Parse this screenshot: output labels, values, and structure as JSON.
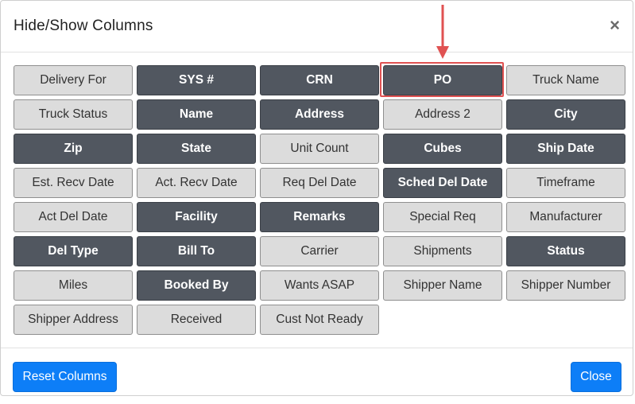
{
  "modal": {
    "title": "Hide/Show Columns",
    "close_glyph": "×"
  },
  "columns": [
    {
      "label": "Delivery For",
      "visible": false
    },
    {
      "label": "SYS #",
      "visible": true
    },
    {
      "label": "CRN",
      "visible": true
    },
    {
      "label": "PO",
      "visible": true,
      "highlighted": true
    },
    {
      "label": "Truck Name",
      "visible": false
    },
    {
      "label": "Truck Status",
      "visible": false
    },
    {
      "label": "Name",
      "visible": true
    },
    {
      "label": "Address",
      "visible": true
    },
    {
      "label": "Address 2",
      "visible": false
    },
    {
      "label": "City",
      "visible": true
    },
    {
      "label": "Zip",
      "visible": true
    },
    {
      "label": "State",
      "visible": true
    },
    {
      "label": "Unit Count",
      "visible": false
    },
    {
      "label": "Cubes",
      "visible": true
    },
    {
      "label": "Ship Date",
      "visible": true
    },
    {
      "label": "Est. Recv Date",
      "visible": false
    },
    {
      "label": "Act. Recv Date",
      "visible": false
    },
    {
      "label": "Req Del Date",
      "visible": false
    },
    {
      "label": "Sched Del Date",
      "visible": true
    },
    {
      "label": "Timeframe",
      "visible": false
    },
    {
      "label": "Act Del Date",
      "visible": false
    },
    {
      "label": "Facility",
      "visible": true
    },
    {
      "label": "Remarks",
      "visible": true
    },
    {
      "label": "Special Req",
      "visible": false
    },
    {
      "label": "Manufacturer",
      "visible": false
    },
    {
      "label": "Del Type",
      "visible": true
    },
    {
      "label": "Bill To",
      "visible": true
    },
    {
      "label": "Carrier",
      "visible": false
    },
    {
      "label": "Shipments",
      "visible": false
    },
    {
      "label": "Status",
      "visible": true
    },
    {
      "label": "Miles",
      "visible": false
    },
    {
      "label": "Booked By",
      "visible": true
    },
    {
      "label": "Wants ASAP",
      "visible": false
    },
    {
      "label": "Shipper Name",
      "visible": false
    },
    {
      "label": "Shipper Number",
      "visible": false
    },
    {
      "label": "Shipper Address",
      "visible": false
    },
    {
      "label": "Received",
      "visible": false
    },
    {
      "label": "Cust Not Ready",
      "visible": false
    }
  ],
  "footer": {
    "reset_label": "Reset Columns",
    "close_label": "Close"
  },
  "colors": {
    "shown_bg": "#515760",
    "hidden_bg": "#dcdcdc",
    "primary": "#0d7ef7",
    "annotation_red": "#e05252"
  }
}
